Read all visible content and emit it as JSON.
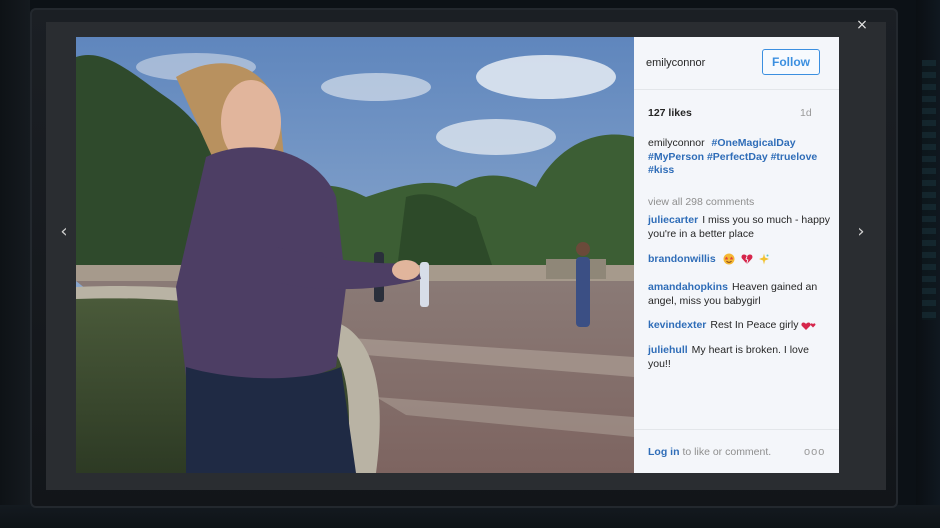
{
  "post": {
    "username": "emilyconnor",
    "follow_label": "Follow",
    "likes": "127 likes",
    "age": "1d",
    "caption_author": "emilyconnor",
    "caption_tags": [
      "#OneMagicalDay",
      "#MyPerson",
      "#PerfectDay",
      "#truelove",
      "#kiss"
    ],
    "view_all": "view all 298 comments"
  },
  "comments": [
    {
      "user": "juliecarter",
      "text": "I miss you so much - happy you're in a better place"
    },
    {
      "user": "brandonwillis",
      "text": ""
    },
    {
      "user": "amandahopkins",
      "text": "Heaven gained an angel, miss you babygirl"
    },
    {
      "user": "kevindexter",
      "text": "Rest In Peace girly"
    },
    {
      "user": "juliehull",
      "text": "My heart is broken. I love you!!"
    }
  ],
  "footer": {
    "login_link": "Log in",
    "login_text": "to like or comment.",
    "more": "ooo"
  },
  "controls": {
    "close": "×",
    "prev": "‹",
    "next": "›"
  },
  "colors": {
    "accent": "#3b8fe0",
    "link": "#2f6db8",
    "panel_bg": "#f4f6fa"
  },
  "icons": {
    "brandon_emojis": [
      "star-struck-face-icon",
      "broken-heart-icon",
      "sparkles-icon"
    ],
    "kevin_emoji": "hearts-icon"
  }
}
